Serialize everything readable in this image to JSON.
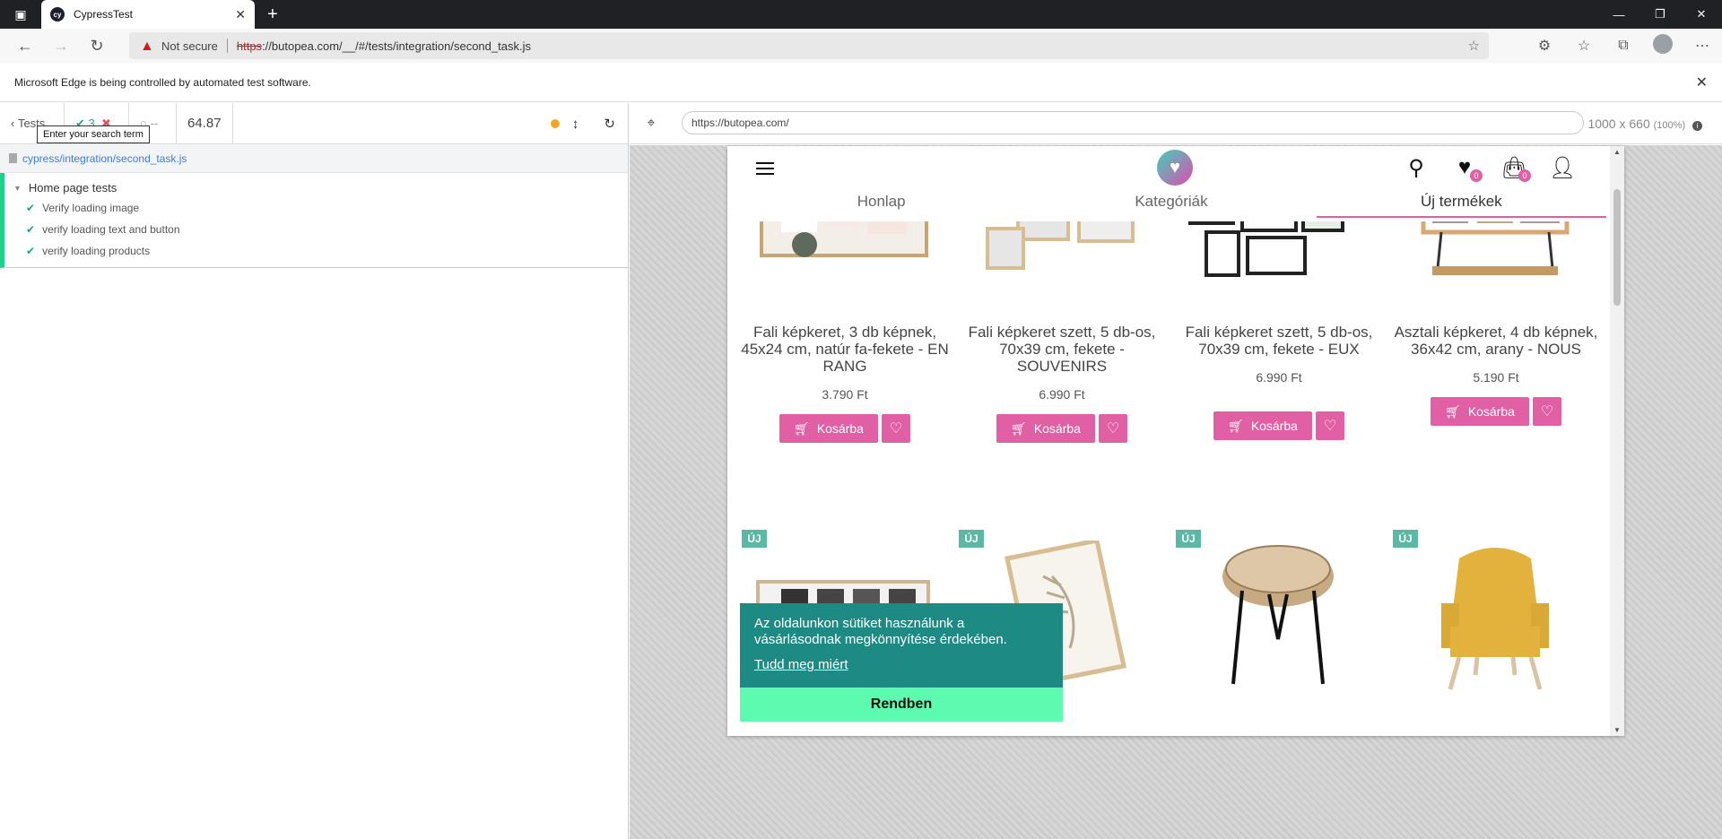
{
  "browser": {
    "tab_title": "CypressTest",
    "not_secure": "Not secure",
    "url_scheme": "https",
    "url_rest": "://butopea.com/__/#/tests/integration/second_task.js",
    "infobar_text": "Microsoft Edge is being controlled by automated test software."
  },
  "reporter": {
    "tests_label": "Tests",
    "passed_count": "3",
    "failed_count": "",
    "pending_count": "--",
    "duration": "64.87",
    "tooltip": "Enter your search term",
    "spec_path": "cypress/integration/second_task.js",
    "suite_title": "Home page tests",
    "tests": [
      {
        "title": "Verify loading image"
      },
      {
        "title": "verify loading text and button"
      },
      {
        "title": "verify loading products"
      }
    ]
  },
  "aut": {
    "url": "https://butopea.com/",
    "viewport": "1000 x 660",
    "zoom": "(100%)"
  },
  "site": {
    "menu": [
      "Honlap",
      "Kategóriák",
      "Új termékek"
    ],
    "badge_wishlist": "0",
    "badge_cart": "0",
    "products": [
      {
        "title": "Fali képkeret, 3 db képnek, 45x24 cm, natúr fa-fekete - EN RANG",
        "price": "3.790 Ft",
        "cart": "Kosárba"
      },
      {
        "title": "Fali képkeret szett, 5 db-os, 70x39 cm, fekete - SOUVENIRS",
        "price": "6.990 Ft",
        "cart": "Kosárba"
      },
      {
        "title": "Fali képkeret szett, 5 db-os, 70x39 cm, fekete - EUX",
        "price": "6.990 Ft",
        "cart": "Kosárba"
      },
      {
        "title": "Asztali képkeret, 4 db képnek, 36x42 cm, arany - NOUS",
        "price": "5.190 Ft",
        "cart": "Kosárba"
      }
    ],
    "new_badge": "ÚJ",
    "cookie_text": "Az oldalunkon sütiket használunk a vásárlásodnak megkönnyítése érdekében.",
    "cookie_link": "Tudd meg miért",
    "cookie_button": "Rendben"
  },
  "colors": {
    "accent_pink": "#e05fa5",
    "cookie_teal": "#1d8a83",
    "cookie_btn": "#5dfbb0",
    "pass_green": "#1fa971"
  }
}
